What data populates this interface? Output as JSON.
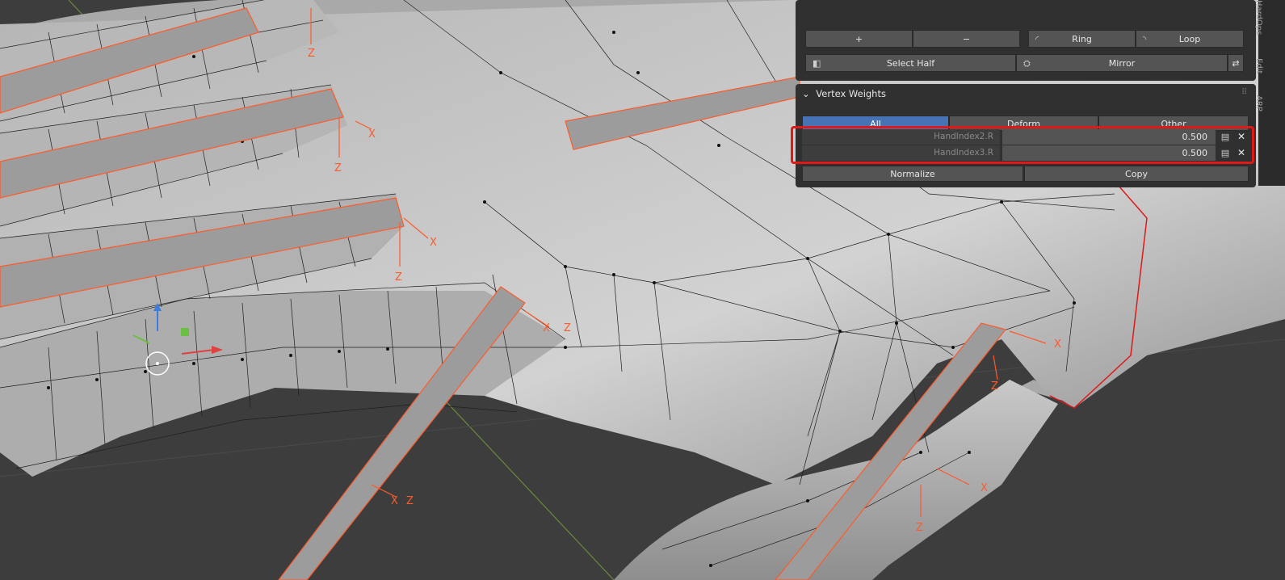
{
  "viewport": {
    "axis_labels": {
      "x": "X",
      "z": "Z"
    }
  },
  "panel": {
    "edit_buttons": {
      "plus": "+",
      "minus": "−",
      "ring": "Ring",
      "loop": "Loop"
    },
    "select_half": "Select Half",
    "mirror": "Mirror",
    "vertex_weights_title": "Vertex Weights",
    "tabs": [
      "All",
      "Deform",
      "Other"
    ],
    "weights": [
      {
        "name": "HandIndex2.R",
        "value": "0.500"
      },
      {
        "name": "HandIndex3.R",
        "value": "0.500"
      }
    ],
    "normalize": "Normalize",
    "copy": "Copy"
  },
  "side_tabs": [
    "ARP",
    "Edit",
    "HardOps"
  ],
  "colors": {
    "bone": "#ff5a2a",
    "selection_highlight": "#e01818",
    "active_tab": "#4772b3",
    "mesh": "#bcbcbc"
  }
}
